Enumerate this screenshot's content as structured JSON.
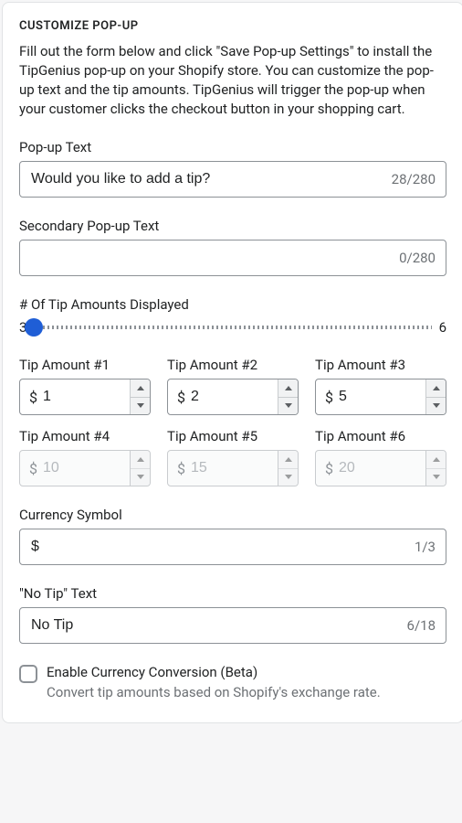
{
  "header": {
    "title": "CUSTOMIZE POP-UP",
    "description": "Fill out the form below and click \"Save Pop-up Settings\" to install the TipGenius pop-up on your Shopify store. You can customize the pop-up text and the tip amounts. TipGenius will trigger the pop-up when your customer clicks the checkout button in your shopping cart."
  },
  "popup_text": {
    "label": "Pop-up Text",
    "value": "Would you like to add a tip?",
    "count": "28/280"
  },
  "secondary_text": {
    "label": "Secondary Pop-up Text",
    "value": "",
    "count": "0/280"
  },
  "slider": {
    "label": "# Of Tip Amounts Displayed",
    "min": "3",
    "max": "6",
    "value": 3
  },
  "amounts": [
    {
      "label": "Tip Amount #1",
      "value": "1",
      "enabled": true
    },
    {
      "label": "Tip Amount #2",
      "value": "2",
      "enabled": true
    },
    {
      "label": "Tip Amount #3",
      "value": "5",
      "enabled": true
    },
    {
      "label": "Tip Amount #4",
      "value": "10",
      "enabled": false
    },
    {
      "label": "Tip Amount #5",
      "value": "15",
      "enabled": false
    },
    {
      "label": "Tip Amount #6",
      "value": "20",
      "enabled": false
    }
  ],
  "currency": {
    "label": "Currency Symbol",
    "value": "$",
    "count": "1/3",
    "symbol": "$"
  },
  "no_tip": {
    "label": "\"No Tip\" Text",
    "value": "No Tip",
    "count": "6/18"
  },
  "conversion": {
    "label": "Enable Currency Conversion (Beta)",
    "help": "Convert tip amounts based on Shopify's exchange rate.",
    "checked": false
  }
}
